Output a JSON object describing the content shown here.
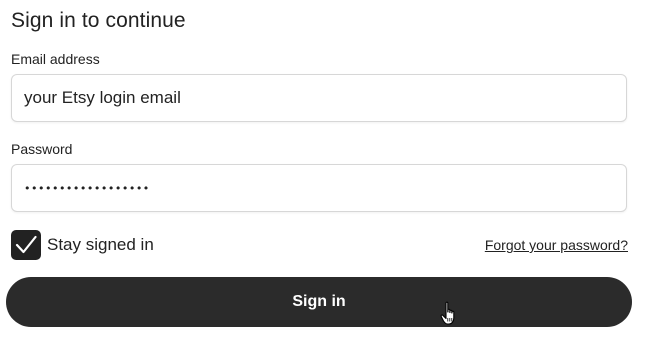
{
  "form": {
    "title": "Sign in to continue",
    "email_label": "Email address",
    "email_value": "your Etsy login email",
    "password_label": "Password",
    "password_value": "••••••••••••••••••",
    "stay_signed_in_label": "Stay signed in",
    "stay_signed_in_checked": true,
    "forgot_password_link": "Forgot your password?",
    "sign_in_button": "Sign in"
  },
  "colors": {
    "button_bg": "#2b2b2b",
    "checkbox_bg": "#222222",
    "field_border": "#d7d7d7"
  },
  "icons": {
    "checkbox": "checkmark-icon",
    "cursor": "hand-pointer-icon"
  }
}
